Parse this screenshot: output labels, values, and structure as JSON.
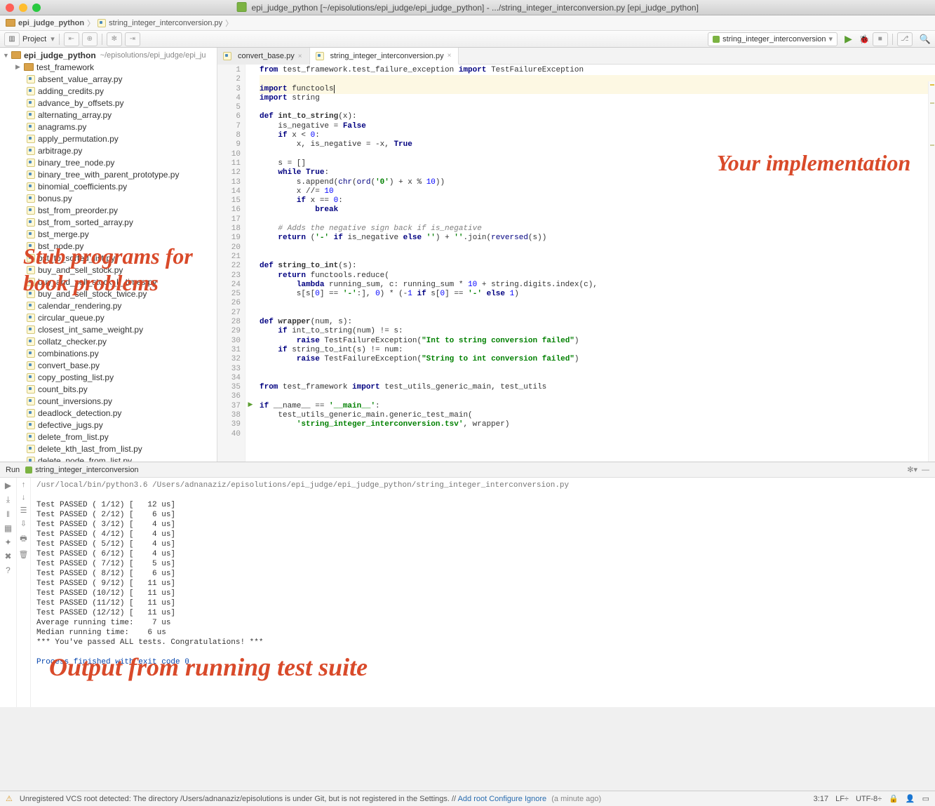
{
  "window": {
    "title": "epi_judge_python [~/episolutions/epi_judge/epi_judge_python] - .../string_integer_interconversion.py [epi_judge_python]"
  },
  "breadcrumbs": {
    "project": "epi_judge_python",
    "file": "string_integer_interconversion.py"
  },
  "toolbar": {
    "project_label": "Project",
    "run_config": "string_integer_interconversion"
  },
  "sidebar": {
    "root_name": "epi_judge_python",
    "root_path": "~/episolutions/epi_judge/epi_ju",
    "folder": "test_framework",
    "files": [
      "absent_value_array.py",
      "adding_credits.py",
      "advance_by_offsets.py",
      "alternating_array.py",
      "anagrams.py",
      "apply_permutation.py",
      "arbitrage.py",
      "binary_tree_node.py",
      "binary_tree_with_parent_prototype.py",
      "binomial_coefficients.py",
      "bonus.py",
      "bst_from_preorder.py",
      "bst_from_sorted_array.py",
      "bst_merge.py",
      "bst_node.py",
      "bst_to_sorted_list.py",
      "buy_and_sell_stock.py",
      "buy_and_sell_stock_k_times.py",
      "buy_and_sell_stock_twice.py",
      "calendar_rendering.py",
      "circular_queue.py",
      "closest_int_same_weight.py",
      "collatz_checker.py",
      "combinations.py",
      "convert_base.py",
      "copy_posting_list.py",
      "count_bits.py",
      "count_inversions.py",
      "deadlock_detection.py",
      "defective_jugs.py",
      "delete_from_list.py",
      "delete_kth_last_from_list.py",
      "delete_node_from_list.py"
    ]
  },
  "tabs": {
    "tab1": "convert_base.py",
    "tab2": "string_integer_interconversion.py"
  },
  "annotations": {
    "stub": "Stub programs for book problems",
    "impl": "Your implementation",
    "output": "Output from running test suite"
  },
  "code_lines": [
    {
      "n": 1,
      "h": "<span class='kw'>from</span> test_framework.test_failure_exception <span class='kw'>import</span> TestFailureException"
    },
    {
      "n": 2,
      "h": "",
      "hl": true
    },
    {
      "n": 3,
      "h": "<span class='kw'>import</span> functool<span class='cursor'>s</span>",
      "hl": true
    },
    {
      "n": 4,
      "h": "<span class='kw'>import</span> string"
    },
    {
      "n": 5,
      "h": ""
    },
    {
      "n": 6,
      "h": "<span class='kw'>def</span> <span class='fn'>int_to_string</span>(x):"
    },
    {
      "n": 7,
      "h": "    is_negative = <span class='kw'>False</span>"
    },
    {
      "n": 8,
      "h": "    <span class='kw'>if</span> x &lt; <span class='num'>0</span>:"
    },
    {
      "n": 9,
      "h": "        x, is_negative = -x, <span class='kw'>True</span>"
    },
    {
      "n": 10,
      "h": ""
    },
    {
      "n": 11,
      "h": "    s = []"
    },
    {
      "n": 12,
      "h": "    <span class='kw'>while</span> <span class='kw'>True</span>:"
    },
    {
      "n": 13,
      "h": "        s.append(<span class='bi'>chr</span>(<span class='bi'>ord</span>(<span class='str'>'0'</span>) + x % <span class='num'>10</span>))"
    },
    {
      "n": 14,
      "h": "        x //= <span class='num'>10</span>"
    },
    {
      "n": 15,
      "h": "        <span class='kw'>if</span> x == <span class='num'>0</span>:"
    },
    {
      "n": 16,
      "h": "            <span class='kw'>break</span>"
    },
    {
      "n": 17,
      "h": ""
    },
    {
      "n": 18,
      "h": "    <span class='cmt'># Adds the negative sign back if is_negative</span>"
    },
    {
      "n": 19,
      "h": "    <span class='kw'>return</span> (<span class='str'>'-'</span> <span class='kw'>if</span> is_negative <span class='kw'>else</span> <span class='str'>''</span>) + <span class='str'>''</span>.join(<span class='bi'>reversed</span>(s))"
    },
    {
      "n": 20,
      "h": ""
    },
    {
      "n": 21,
      "h": ""
    },
    {
      "n": 22,
      "h": "<span class='kw'>def</span> <span class='fn'>string_to_int</span>(s):"
    },
    {
      "n": 23,
      "h": "    <span class='kw'>return</span> functools.reduce("
    },
    {
      "n": 24,
      "h": "        <span class='kw'>lambda</span> running_sum, c: running_sum * <span class='num'>10</span> + string.digits.index(c),"
    },
    {
      "n": 25,
      "h": "        s[s[<span class='num'>0</span>] == <span class='str'>'-'</span>:], <span class='num'>0</span>) * (-<span class='num'>1</span> <span class='kw'>if</span> s[<span class='num'>0</span>] == <span class='str'>'-'</span> <span class='kw'>else</span> <span class='num'>1</span>)"
    },
    {
      "n": 26,
      "h": ""
    },
    {
      "n": 27,
      "h": ""
    },
    {
      "n": 28,
      "h": "<span class='kw'>def</span> <span class='fn'>wrapper</span>(num, s):"
    },
    {
      "n": 29,
      "h": "    <span class='kw'>if</span> int_to_string(num) != s:"
    },
    {
      "n": 30,
      "h": "        <span class='kw'>raise</span> TestFailureException(<span class='str'>\"Int to string conversion failed\"</span>)"
    },
    {
      "n": 31,
      "h": "    <span class='kw'>if</span> string_to_int(s) != num:"
    },
    {
      "n": 32,
      "h": "        <span class='kw'>raise</span> TestFailureException(<span class='str'>\"String to int conversion failed\"</span>)"
    },
    {
      "n": 33,
      "h": ""
    },
    {
      "n": 34,
      "h": ""
    },
    {
      "n": 35,
      "h": "<span class='kw'>from</span> test_framework <span class='kw'>import</span> test_utils_generic_main, test_utils"
    },
    {
      "n": 36,
      "h": ""
    },
    {
      "n": 37,
      "h": "<span class='kw'>if</span> __name__ == <span class='str'>'__main__'</span>:",
      "bp": true
    },
    {
      "n": 38,
      "h": "    test_utils_generic_main.generic_test_main("
    },
    {
      "n": 39,
      "h": "        <span class='str'>'string_integer_interconversion.tsv'</span>, wrapper)"
    },
    {
      "n": 40,
      "h": ""
    }
  ],
  "console": {
    "run_label": "Run",
    "tab_label": "string_integer_interconversion",
    "cmd": "/usr/local/bin/python3.6 /Users/adnanaziz/episolutions/epi_judge/epi_judge_python/string_integer_interconversion.py",
    "tests": [
      "Test PASSED ( 1/12) [   12 us]",
      "Test PASSED ( 2/12) [    6 us]",
      "Test PASSED ( 3/12) [    4 us]",
      "Test PASSED ( 4/12) [    4 us]",
      "Test PASSED ( 5/12) [    4 us]",
      "Test PASSED ( 6/12) [    4 us]",
      "Test PASSED ( 7/12) [    5 us]",
      "Test PASSED ( 8/12) [    6 us]",
      "Test PASSED ( 9/12) [   11 us]",
      "Test PASSED (10/12) [   11 us]",
      "Test PASSED (11/12) [   11 us]",
      "Test PASSED (12/12) [   11 us]"
    ],
    "avg": "Average running time:    7 us",
    "med": "Median running time:    6 us",
    "congrats": "*** You've passed ALL tests. Congratulations! ***",
    "exit": "Process finished with exit code 0"
  },
  "status": {
    "vcs_msg": "Unregistered VCS root detected: The directory /Users/adnanaziz/episolutions is under Git, but is not registered in the Settings. //",
    "add_root": "Add root",
    "configure": "Configure",
    "ignore": "Ignore",
    "ago": "(a minute ago)",
    "pos": "3:17",
    "lf": "LF",
    "enc": "UTF-8"
  }
}
